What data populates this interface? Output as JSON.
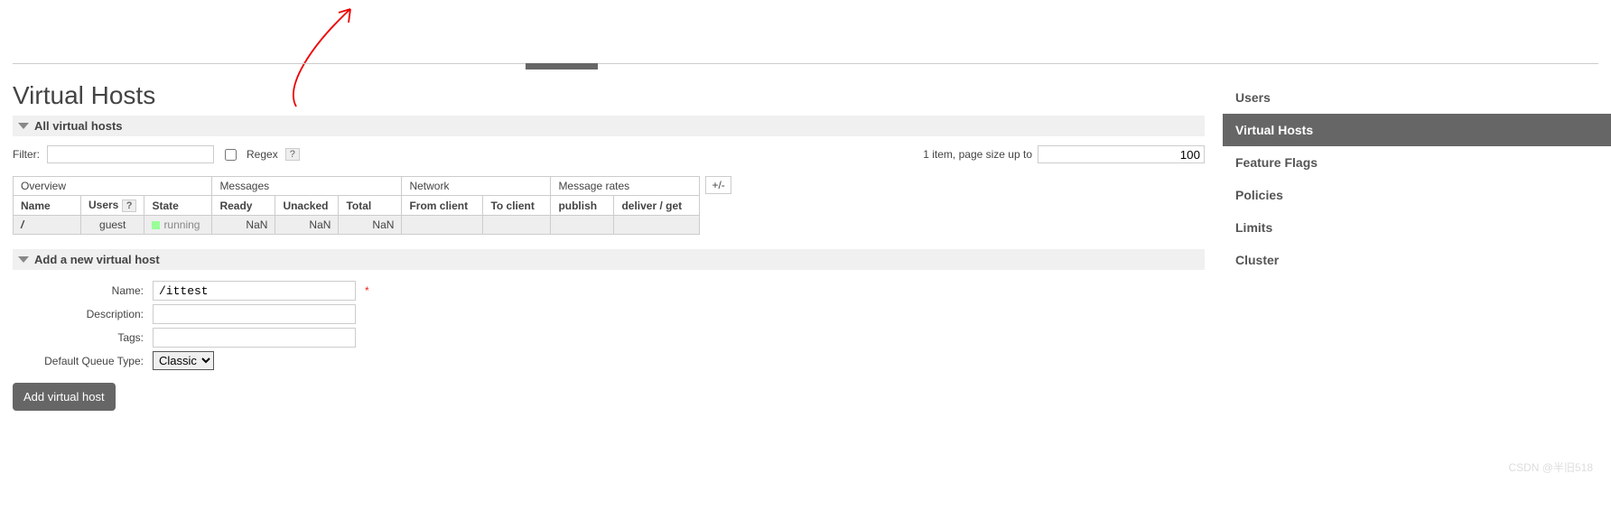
{
  "page": {
    "title": "Virtual Hosts",
    "section_all": "All virtual hosts",
    "section_add": "Add a new virtual host"
  },
  "filter": {
    "label": "Filter:",
    "value": "",
    "regex_label": "Regex",
    "help": "?"
  },
  "pager": {
    "text": "1 item, page size up to",
    "value": "100"
  },
  "columns": {
    "groups": {
      "overview": "Overview",
      "messages": "Messages",
      "network": "Network",
      "rates": "Message rates"
    },
    "plusminus": "+/-",
    "name": "Name",
    "users": "Users",
    "users_help": "?",
    "state": "State",
    "ready": "Ready",
    "unacked": "Unacked",
    "total": "Total",
    "from_client": "From client",
    "to_client": "To client",
    "publish": "publish",
    "deliver_get": "deliver / get"
  },
  "rows": [
    {
      "name": "/",
      "users": "guest",
      "state": "running",
      "ready": "NaN",
      "unacked": "NaN",
      "total": "NaN",
      "from_client": "",
      "to_client": "",
      "publish": "",
      "deliver_get": ""
    }
  ],
  "form": {
    "name_label": "Name:",
    "name_value": "/ittest",
    "required": "*",
    "description_label": "Description:",
    "description_value": "",
    "tags_label": "Tags:",
    "tags_value": "",
    "dqt_label": "Default Queue Type:",
    "dqt_value": "Classic",
    "submit": "Add virtual host"
  },
  "sidebar": [
    {
      "label": "Users",
      "active": false
    },
    {
      "label": "Virtual Hosts",
      "active": true
    },
    {
      "label": "Feature Flags",
      "active": false
    },
    {
      "label": "Policies",
      "active": false
    },
    {
      "label": "Limits",
      "active": false
    },
    {
      "label": "Cluster",
      "active": false
    }
  ],
  "watermark": "CSDN @半旧518"
}
